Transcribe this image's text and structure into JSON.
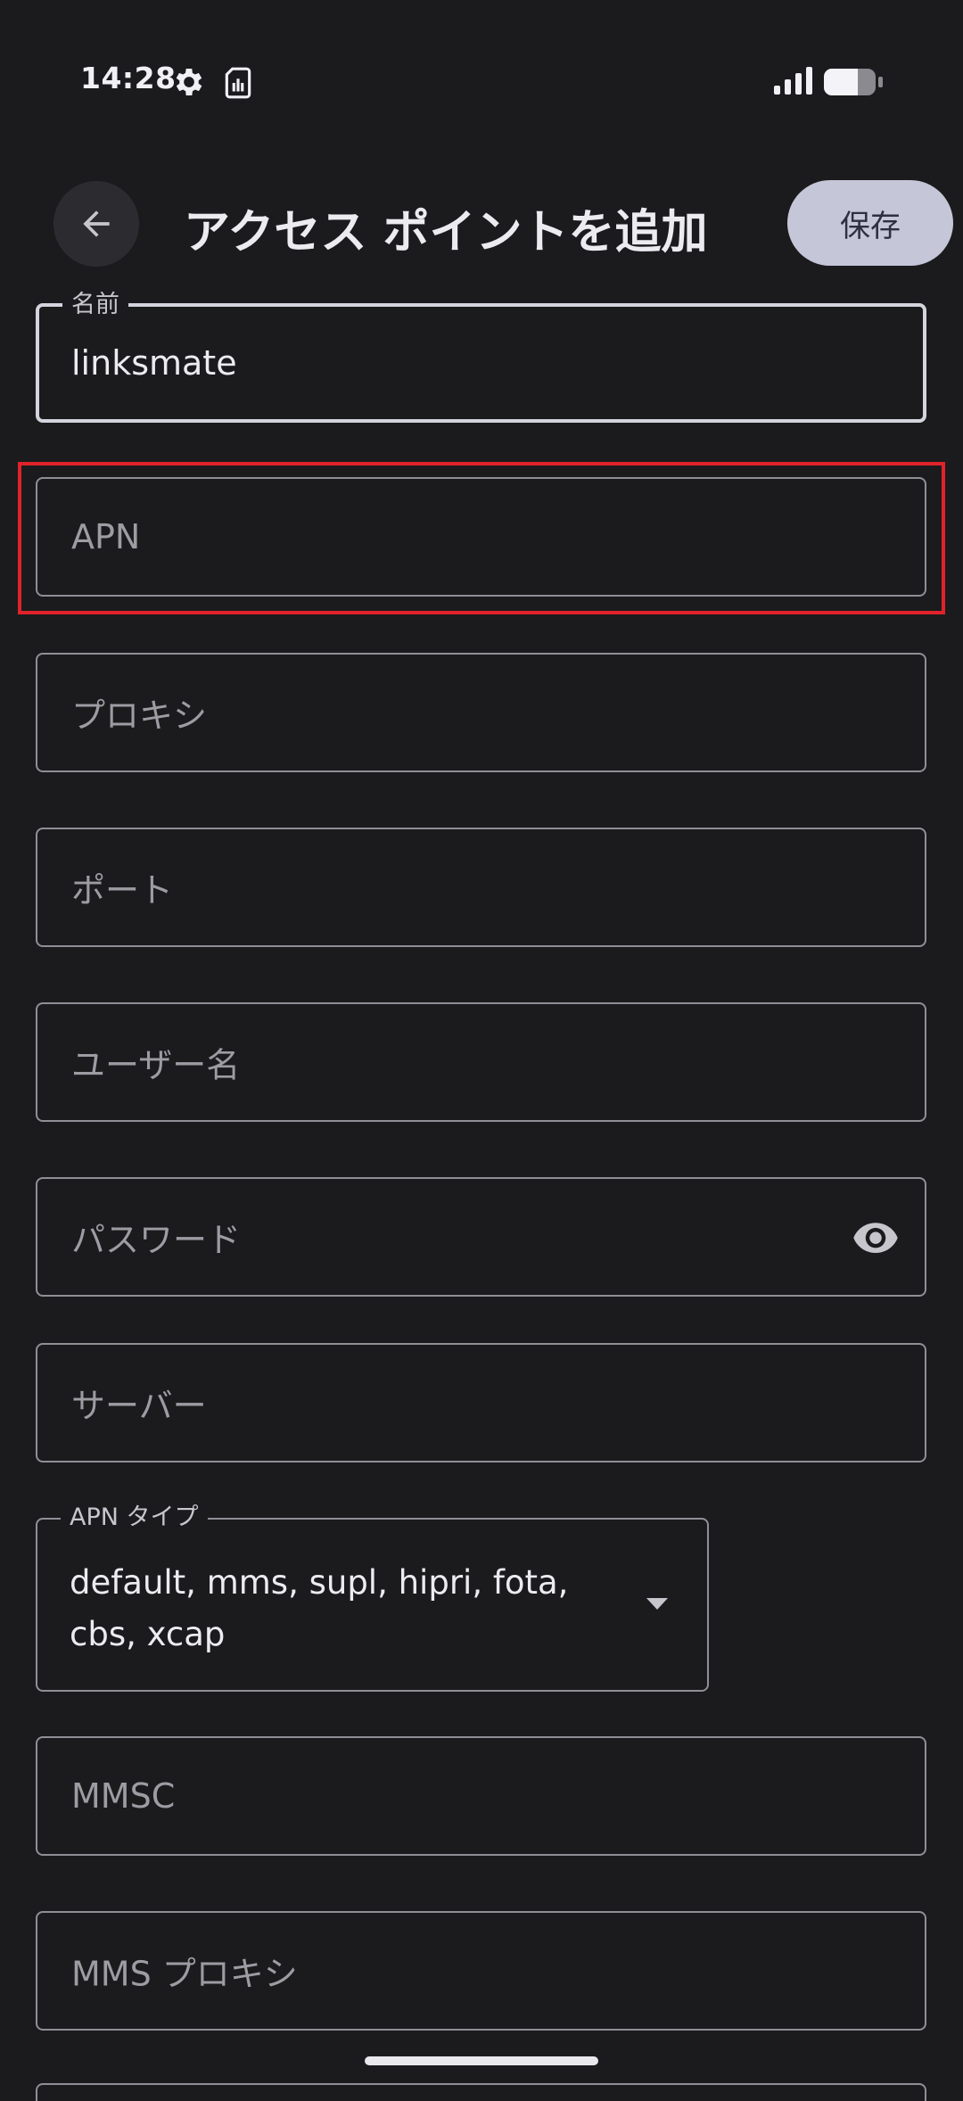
{
  "status_bar": {
    "time": "14:28",
    "icons": [
      "gear-icon",
      "sim-card-icon",
      "signal-icon",
      "battery-icon"
    ]
  },
  "header": {
    "back_icon": "arrow-left-icon",
    "title": "アクセス ポイントを追加",
    "save_label": "保存"
  },
  "form": {
    "name": {
      "label": "名前",
      "value": "linksmate"
    },
    "apn": {
      "placeholder": "APN"
    },
    "proxy": {
      "placeholder": "プロキシ"
    },
    "port": {
      "placeholder": "ポート"
    },
    "username": {
      "placeholder": "ユーザー名"
    },
    "password": {
      "placeholder": "パスワード",
      "icon": "eye-icon"
    },
    "server": {
      "placeholder": "サーバー"
    },
    "apn_type": {
      "label": "APN タイプ",
      "value": "default, mms, supl, hipri, fota, cbs, xcap",
      "icon": "dropdown-arrow-icon"
    },
    "mmsc": {
      "placeholder": "MMSC"
    },
    "mms_proxy": {
      "placeholder": "MMS プロキシ"
    }
  },
  "colors": {
    "background": "#1b1b1d",
    "highlight": "#e0232a",
    "save_button": "#c5c6d8"
  }
}
